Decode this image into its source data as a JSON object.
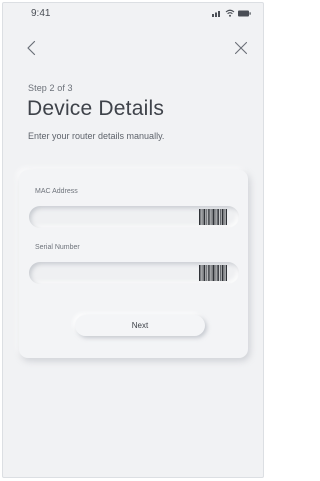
{
  "status_bar": {
    "time": "9:41",
    "icons": [
      "signal-icon",
      "wifi-icon",
      "battery-icon"
    ]
  },
  "nav": {
    "back_icon": "chevron-left-icon",
    "close_icon": "close-icon"
  },
  "header": {
    "step": "Step 2 of 3",
    "title": "Device Details",
    "subtitle": "Enter your router details manually."
  },
  "form": {
    "mac": {
      "label": "MAC Address",
      "value": "",
      "scan_icon": "barcode-scan-icon"
    },
    "serial": {
      "label": "Serial Number",
      "value": "",
      "scan_icon": "barcode-scan-icon"
    },
    "next_label": "Next"
  },
  "colors": {
    "background": "#f1f2f4",
    "card": "#f3f4f6",
    "text": "#3f434a"
  }
}
